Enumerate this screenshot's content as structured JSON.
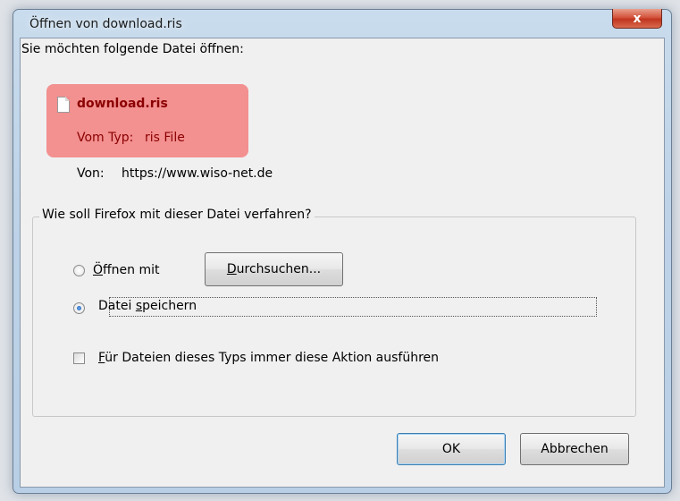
{
  "window": {
    "title": "Öffnen von download.ris",
    "close_label": "x"
  },
  "dialog": {
    "prompt": "Sie möchten folgende Datei öffnen:",
    "file_name": "download.ris",
    "type_label": "Vom Typ:",
    "type_value": "ris File",
    "from_label": "Von:",
    "from_value": "https://www.wiso-net.de"
  },
  "action_group": {
    "legend": "Wie soll Firefox mit dieser Datei verfahren?",
    "open_with_mnemonic": "Ö",
    "open_with_rest": "ffnen mit",
    "open_with_selected": false,
    "browse_mnemonic": "D",
    "browse_rest": "urchsuchen...",
    "save_prefix": "Datei ",
    "save_mnemonic": "s",
    "save_rest": "peichern",
    "save_selected": true,
    "always_mnemonic": "F",
    "always_rest": "ür Dateien dieses Typs immer diese Aktion ausführen",
    "always_checked": false
  },
  "buttons": {
    "ok": "OK",
    "cancel": "Abbrechen"
  }
}
